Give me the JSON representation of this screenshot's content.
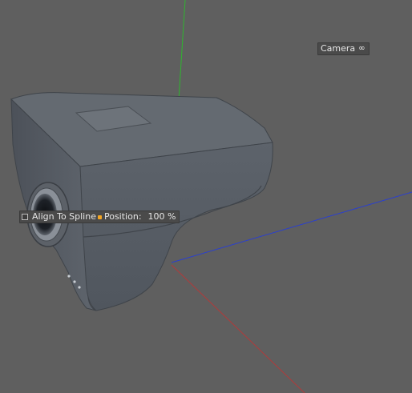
{
  "viewport": {
    "camera_label": "Camera",
    "camera_link_icon": "link-icon",
    "background_color": "#5f5f5f",
    "axis_colors": {
      "x": "#b23a3a",
      "y": "#2fb52f",
      "z": "#2a3fd0"
    }
  },
  "handle": {
    "checkbox_label": "Align To Spline",
    "position_label": "Position:",
    "position_value": "100 %",
    "handle_color": "#f5a623"
  },
  "object": {
    "body_color": "#5a6068",
    "top_color": "#666c73"
  }
}
